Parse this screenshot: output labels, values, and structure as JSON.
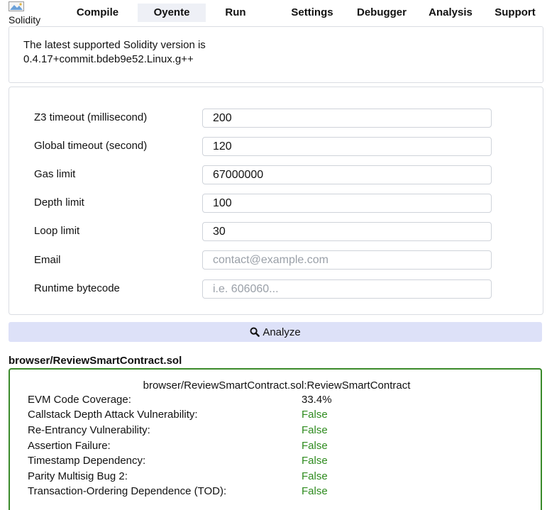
{
  "topbar": {
    "logo_alt": "Solidity realtime compiler and runtime",
    "tabs": [
      {
        "label": "Compile",
        "active": false
      },
      {
        "label": "Oyente",
        "active": true
      },
      {
        "label": "Run",
        "active": false
      },
      {
        "label": "Settings",
        "active": false
      },
      {
        "label": "Debugger",
        "active": false
      },
      {
        "label": "Analysis",
        "active": false
      },
      {
        "label": "Support",
        "active": false
      }
    ]
  },
  "info": {
    "line1": "The latest supported Solidity version is",
    "line2": "0.4.17+commit.bdeb9e52.Linux.g++"
  },
  "settings": {
    "fields": [
      {
        "label": "Z3 timeout (millisecond)",
        "value": "200",
        "placeholder": ""
      },
      {
        "label": "Global timeout (second)",
        "value": "120",
        "placeholder": ""
      },
      {
        "label": "Gas limit",
        "value": "67000000",
        "placeholder": ""
      },
      {
        "label": "Depth limit",
        "value": "100",
        "placeholder": ""
      },
      {
        "label": "Loop limit",
        "value": "30",
        "placeholder": ""
      },
      {
        "label": "Email",
        "value": "",
        "placeholder": "contact@example.com"
      },
      {
        "label": "Runtime bytecode",
        "value": "",
        "placeholder": "i.e. 606060..."
      }
    ]
  },
  "analyze": {
    "label": "Analyze",
    "icon": "search-icon"
  },
  "results": {
    "file": "browser/ReviewSmartContract.sol",
    "contract": "browser/ReviewSmartContract.sol:ReviewSmartContract",
    "rows": [
      {
        "label": "EVM Code Coverage:",
        "value": "33.4%"
      },
      {
        "label": "Callstack Depth Attack Vulnerability:",
        "value": "False"
      },
      {
        "label": "Re-Entrancy Vulnerability:",
        "value": "False"
      },
      {
        "label": "Assertion Failure:",
        "value": "False"
      },
      {
        "label": "Timestamp Dependency:",
        "value": "False"
      },
      {
        "label": "Parity Multisig Bug 2:",
        "value": "False"
      },
      {
        "label": "Transaction-Ordering Dependence (TOD):",
        "value": "False"
      }
    ]
  },
  "colors": {
    "accent": "#dde1f8",
    "success": "#2e8b1e",
    "result_border": "#3a8a2a"
  }
}
